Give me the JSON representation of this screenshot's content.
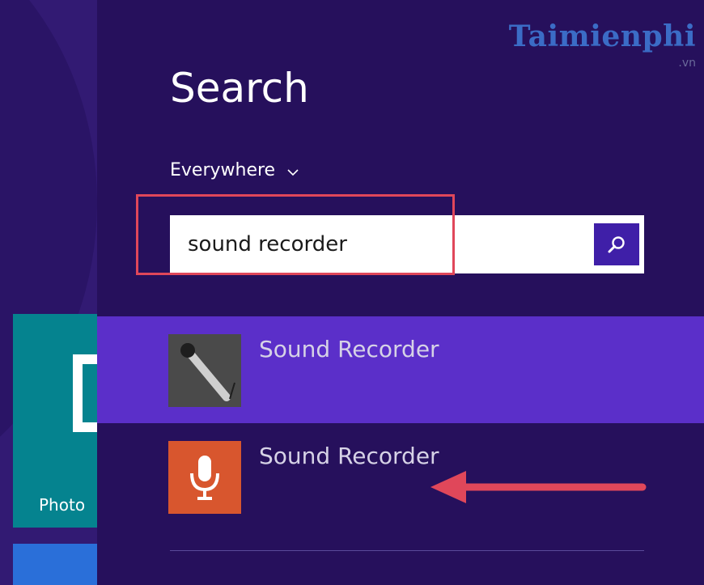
{
  "start_screen": {
    "tile_label": "Photo"
  },
  "search_pane": {
    "title": "Search",
    "scope": "Everywhere",
    "query": "sound recorder",
    "results": [
      {
        "label": "Sound Recorder",
        "icon": "microphone-desktop-icon"
      },
      {
        "label": "Sound Recorder",
        "icon": "microphone-app-icon"
      }
    ]
  },
  "watermark": {
    "brand": "Taimienphi",
    "suffix": ".vn"
  },
  "colors": {
    "pane_background": "#26105c",
    "selected_result": "#5b2fc9",
    "highlight_border": "#e0475a",
    "arrow": "#e0475a"
  }
}
